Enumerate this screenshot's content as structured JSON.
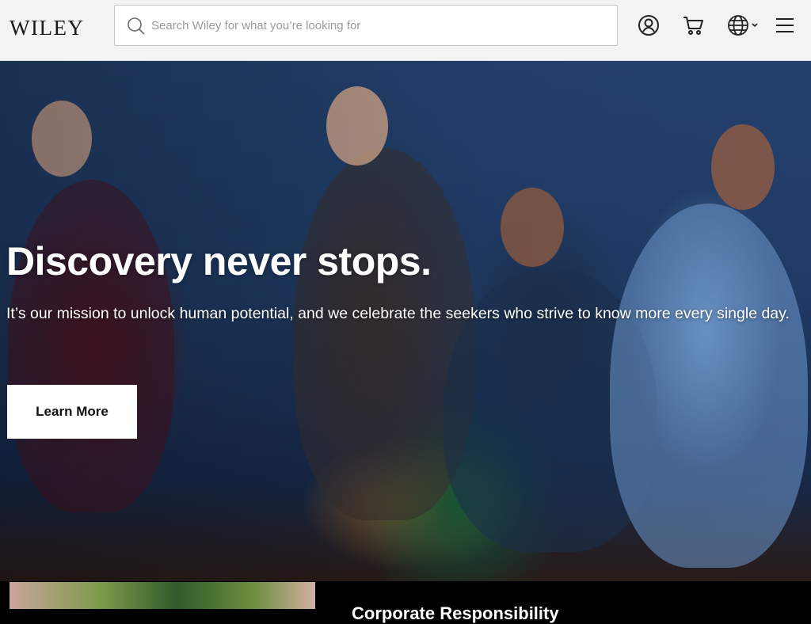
{
  "header": {
    "logo_text": "Wiley",
    "search": {
      "placeholder": "Search Wiley for what you’re looking for"
    },
    "icons": [
      "account-icon",
      "cart-icon",
      "globe-icon",
      "menu-icon"
    ]
  },
  "hero": {
    "title": "Discovery never stops.",
    "description": "It’s our mission to unlock human potential, and we celebrate the seekers who strive to know more every single day.",
    "cta_label": "Learn More"
  },
  "bottom": {
    "card_title": "Corporate Responsibility"
  },
  "colors": {
    "header_bg": "#f3f3f3",
    "hero_bg": "#24416e",
    "cta_bg": "#ffffff",
    "text_light": "#ffffff"
  }
}
